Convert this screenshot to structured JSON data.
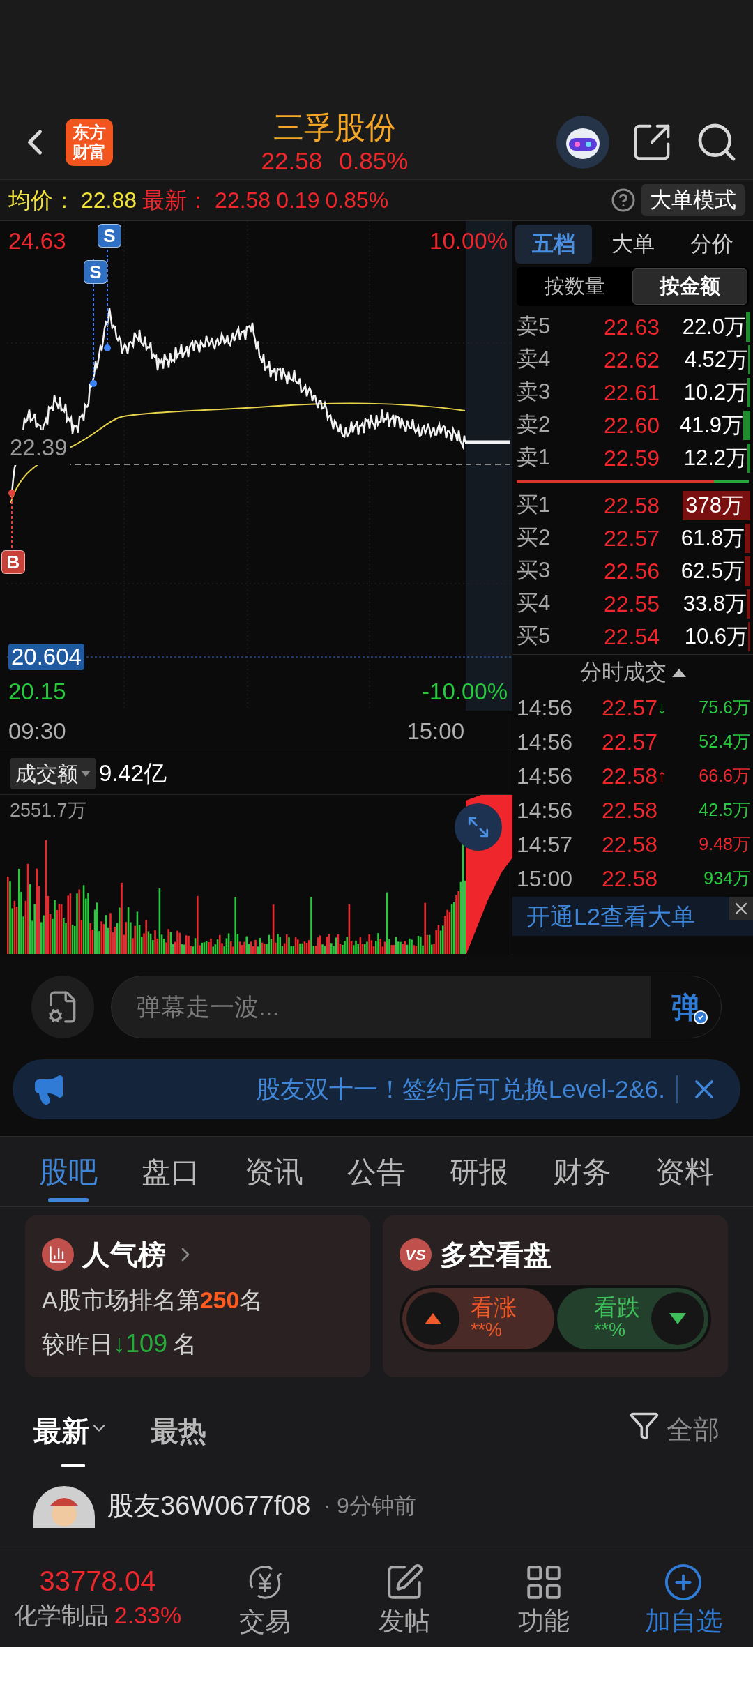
{
  "header": {
    "logo": [
      "东方",
      "财富"
    ],
    "title": "三孚股份",
    "price": "22.58",
    "change": "0.85%"
  },
  "quote_bar": {
    "avg_label": "均价：",
    "avg": "22.88",
    "last_label": "最新：",
    "last": "22.58",
    "change": "0.19",
    "change_pct": "0.85%",
    "mode_button": "大单模式"
  },
  "chart": {
    "high": "24.63",
    "high_pct": "10.00%",
    "prev_close": "22.39",
    "cursor_price": "20.604",
    "low": "20.15",
    "low_pct": "-10.00%",
    "times": [
      "09:30",
      "15:00"
    ],
    "markers": [
      {
        "label": "S",
        "kind": "sell"
      },
      {
        "label": "S",
        "kind": "sell"
      },
      {
        "label": "B",
        "kind": "buy"
      }
    ],
    "volume_selector": "成交额",
    "volume_total": "9.42亿",
    "volume_max": "2551.7万"
  },
  "order_book": {
    "tabs": [
      {
        "label": "五档",
        "selected": true
      },
      {
        "label": "大单",
        "selected": false
      },
      {
        "label": "分价",
        "selected": false
      }
    ],
    "modes": [
      {
        "label": "按数量",
        "selected": false
      },
      {
        "label": "按金额",
        "selected": true
      }
    ],
    "asks": [
      {
        "label": "卖5",
        "price": "22.63",
        "amount": "22.0万"
      },
      {
        "label": "卖4",
        "price": "22.62",
        "amount": "4.52万"
      },
      {
        "label": "卖3",
        "price": "22.61",
        "amount": "10.2万"
      },
      {
        "label": "卖2",
        "price": "22.60",
        "amount": "41.9万"
      },
      {
        "label": "卖1",
        "price": "22.59",
        "amount": "12.2万"
      }
    ],
    "bids": [
      {
        "label": "买1",
        "price": "22.58",
        "amount": "378万"
      },
      {
        "label": "买2",
        "price": "22.57",
        "amount": "61.8万"
      },
      {
        "label": "买3",
        "price": "22.56",
        "amount": "62.5万"
      },
      {
        "label": "买4",
        "price": "22.55",
        "amount": "33.8万"
      },
      {
        "label": "买5",
        "price": "22.54",
        "amount": "10.6万"
      }
    ],
    "trades_title": "分时成交",
    "trades": [
      {
        "time": "14:56",
        "price": "22.57",
        "arrow": "↓",
        "amount": "75.6万",
        "color": "#27c93f"
      },
      {
        "time": "14:56",
        "price": "22.57",
        "amount": "52.4万",
        "color": "#27c93f"
      },
      {
        "time": "14:56",
        "price": "22.58",
        "arrow": "↑",
        "amount": "66.6万",
        "color": "#f0262d"
      },
      {
        "time": "14:56",
        "price": "22.58",
        "amount": "42.5万",
        "color": "#27c93f"
      },
      {
        "time": "14:57",
        "price": "22.58",
        "amount": "9.48万",
        "color": "#f0262d"
      },
      {
        "time": "15:00",
        "price": "22.58",
        "amount": "934万",
        "color": "#27c93f"
      }
    ],
    "l2_banner": "开通L2查看大单"
  },
  "comment_box": {
    "placeholder": "弹幕走一波...",
    "send": "弹"
  },
  "announcement": "股友双十一！签约后可兑换Level-2&6.",
  "tabs": [
    {
      "label": "股吧",
      "selected": true
    },
    {
      "label": "盘口",
      "selected": false
    },
    {
      "label": "资讯",
      "selected": false
    },
    {
      "label": "公告",
      "selected": false
    },
    {
      "label": "研报",
      "selected": false
    },
    {
      "label": "财务",
      "selected": false
    },
    {
      "label": "资料",
      "selected": false
    }
  ],
  "cards": {
    "popularity": {
      "title": "人气榜",
      "rank_text": "A股市场排名第**250**名",
      "change_prefix": "较昨日",
      "change_arrow": "↓",
      "change": "109",
      "change_suffix": "名"
    },
    "sentiment": {
      "badge": "VS",
      "title": "多空看盘",
      "options": [
        {
          "kind": "up",
          "label": "看涨",
          "value": "**%"
        },
        {
          "kind": "down",
          "label": "看跌",
          "value": "**%"
        }
      ]
    }
  },
  "feed": {
    "sort": [
      {
        "label": "最新",
        "selected": true
      },
      {
        "label": "最热",
        "selected": false
      }
    ],
    "filter": "全部",
    "post": {
      "user": "股友36W0677f08",
      "time": "· 9分钟前"
    }
  },
  "bottom_bar": {
    "index_value": "33778.04",
    "sector": "化学制品",
    "sector_change": "2.33%",
    "items": [
      {
        "kind": "trade",
        "label": "交易"
      },
      {
        "kind": "post",
        "label": "发帖"
      },
      {
        "kind": "tools",
        "label": "功能"
      },
      {
        "kind": "add",
        "label": "加自选"
      }
    ]
  }
}
